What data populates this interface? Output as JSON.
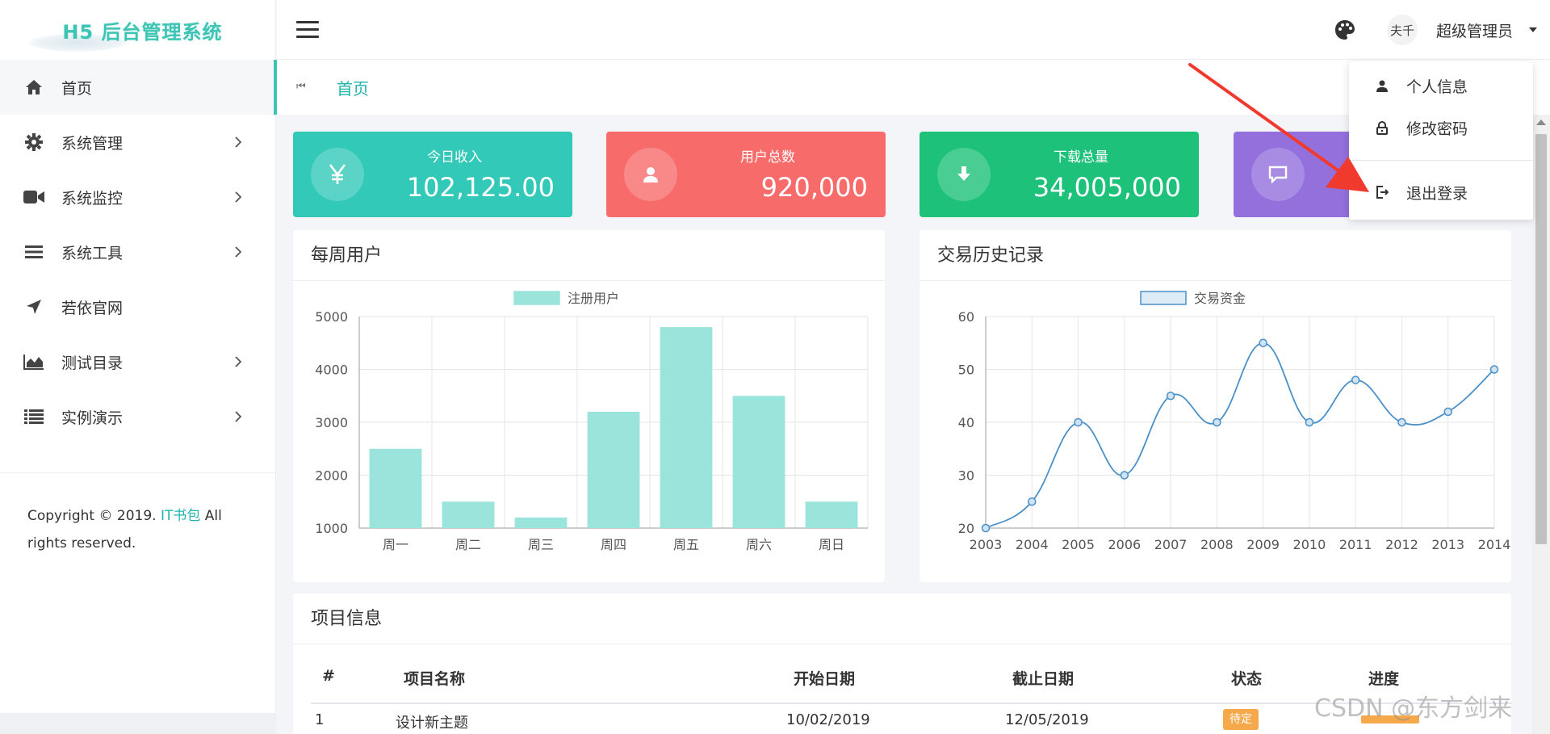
{
  "app": {
    "logo_text": "H5 后台管理系统"
  },
  "sidebar": {
    "items": [
      {
        "label": "首页",
        "icon": "home-icon",
        "has_submenu": false
      },
      {
        "label": "系统管理",
        "icon": "gear-icon",
        "has_submenu": true
      },
      {
        "label": "系统监控",
        "icon": "video-camera-icon",
        "has_submenu": true
      },
      {
        "label": "系统工具",
        "icon": "bars-icon",
        "has_submenu": true
      },
      {
        "label": "若依官网",
        "icon": "location-arrow-icon",
        "has_submenu": false
      },
      {
        "label": "测试目录",
        "icon": "area-chart-icon",
        "has_submenu": true
      },
      {
        "label": "实例演示",
        "icon": "list-icon",
        "has_submenu": true
      }
    ],
    "copyright_prefix": "Copyright © 2019.",
    "copyright_brand": "IT书包",
    "copyright_suffix": "All rights reserved."
  },
  "header": {
    "user_name": "超级管理员",
    "avatar_text": "夫千"
  },
  "tabs": {
    "active": "首页"
  },
  "stats": [
    {
      "label": "今日收入",
      "value": "102,125.00",
      "icon": "yen-icon",
      "color": "#33c9b8"
    },
    {
      "label": "用户总数",
      "value": "920,000",
      "icon": "user-icon",
      "color": "#f86b6b"
    },
    {
      "label": "下载总量",
      "value": "34,005,000",
      "icon": "download-icon",
      "color": "#1dc179"
    },
    {
      "label": "",
      "value": "",
      "icon": "comment-icon",
      "color": "#9370dc"
    }
  ],
  "weekly_panel": {
    "title": "每周用户"
  },
  "trade_panel": {
    "title": "交易历史记录"
  },
  "chart_data": [
    {
      "type": "bar",
      "title": "",
      "categories": [
        "周一",
        "周二",
        "周三",
        "周四",
        "周五",
        "周六",
        "周日"
      ],
      "series": [
        {
          "name": "注册用户",
          "values": [
            2500,
            1500,
            1200,
            3200,
            4800,
            3500,
            1500
          ]
        }
      ],
      "ylim": [
        1000,
        5000
      ],
      "yticks": [
        "1000",
        "2000",
        "3000",
        "4000",
        "5000"
      ],
      "grid": true,
      "legend": "top-center",
      "color": "#9ae4db"
    },
    {
      "type": "line",
      "title": "",
      "x": [
        "2003",
        "2004",
        "2005",
        "2006",
        "2007",
        "2008",
        "2009",
        "2010",
        "2011",
        "2012",
        "2013",
        "2014"
      ],
      "series": [
        {
          "name": "交易资金",
          "values": [
            20,
            25,
            40,
            30,
            45,
            40,
            55,
            40,
            48,
            40,
            42,
            50
          ]
        }
      ],
      "ylim": [
        20,
        60
      ],
      "yticks": [
        "20",
        "30",
        "40",
        "50",
        "60"
      ],
      "grid": true,
      "legend": "top-center",
      "color": "#4a90c8"
    }
  ],
  "projects": {
    "title": "项目信息",
    "columns": [
      "#",
      "项目名称",
      "开始日期",
      "截止日期",
      "状态",
      "进度"
    ],
    "rows": [
      {
        "no": "1",
        "name": "设计新主题",
        "start": "10/02/2019",
        "end": "12/05/2019",
        "status": "待定"
      }
    ]
  },
  "user_menu": {
    "items": [
      {
        "label": "个人信息",
        "icon": "user-icon"
      },
      {
        "label": "修改密码",
        "icon": "lock-icon"
      },
      {
        "label": "退出登录",
        "icon": "sign-out-icon"
      }
    ]
  },
  "watermark": "CSDN @东方剑来"
}
